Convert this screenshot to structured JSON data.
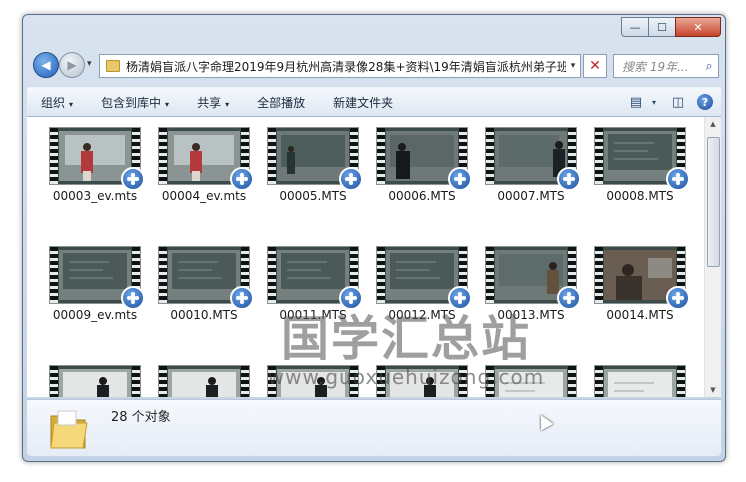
{
  "window": {
    "minimize": "—",
    "maximize": "☐",
    "close": "✕"
  },
  "nav": {
    "back_glyph": "◀",
    "forward_glyph": "▶",
    "history_glyph": "▾",
    "address": "杨清娟盲派八字命理2019年9月杭州高清录像28集+资料\\19年清娟盲派杭州弟子班",
    "address_drop": "▾",
    "refresh_glyph": "✕",
    "search_placeholder": "搜索 19年...",
    "search_icon": "⌕"
  },
  "toolbar": {
    "items": [
      {
        "label": "组织",
        "caret": "▾"
      },
      {
        "label": "包含到库中",
        "caret": "▾"
      },
      {
        "label": "共享",
        "caret": "▾"
      },
      {
        "label": "全部播放",
        "caret": ""
      },
      {
        "label": "新建文件夹",
        "caret": ""
      }
    ],
    "view_icon": "▤",
    "view_caret": "▾",
    "pane_icon": "◫",
    "help_icon": "?"
  },
  "files": [
    {
      "name": "00003_ev.mts",
      "scene": "presenter-red"
    },
    {
      "name": "00004_ev.mts",
      "scene": "presenter-red"
    },
    {
      "name": "00005.MTS",
      "scene": "presenter-board"
    },
    {
      "name": "00006.MTS",
      "scene": "presenter-dark"
    },
    {
      "name": "00007.MTS",
      "scene": "presenter-side"
    },
    {
      "name": "00008.MTS",
      "scene": "board"
    },
    {
      "name": "00009_ev.mts",
      "scene": "board"
    },
    {
      "name": "00010.MTS",
      "scene": "board"
    },
    {
      "name": "00011.MTS",
      "scene": "board"
    },
    {
      "name": "00012.MTS",
      "scene": "board"
    },
    {
      "name": "00013.MTS",
      "scene": "presenter-center"
    },
    {
      "name": "00014.MTS",
      "scene": "audience"
    },
    {
      "name": "",
      "scene": "whiteboard-person"
    },
    {
      "name": "",
      "scene": "whiteboard-person"
    },
    {
      "name": "",
      "scene": "whiteboard-person"
    },
    {
      "name": "",
      "scene": "whiteboard-person"
    },
    {
      "name": "",
      "scene": "whiteboard"
    },
    {
      "name": "",
      "scene": "whiteboard"
    }
  ],
  "watermark": {
    "title": "国学汇总站",
    "url": "www.guoxuehuizong.com"
  },
  "status": {
    "count": "28 个对象"
  },
  "colors": {
    "accent": "#1f5fb8",
    "close": "#c8442c",
    "toolbar": "#dde7f3"
  }
}
